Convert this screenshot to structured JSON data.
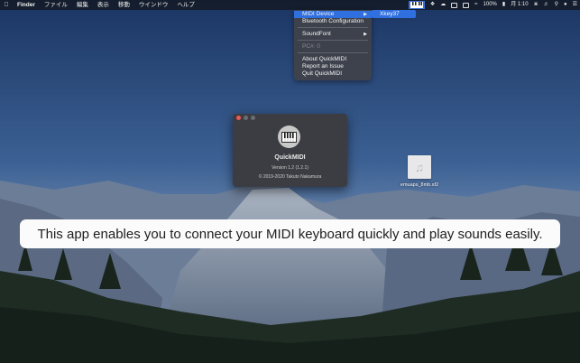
{
  "menubar": {
    "apple_icon": "apple-icon",
    "app_name": "Finder",
    "items": [
      "ファイル",
      "編集",
      "表示",
      "移動",
      "ウインドウ",
      "ヘルプ"
    ],
    "status": {
      "battery": "100%",
      "clock": "月 1:10"
    }
  },
  "menu": {
    "items": [
      {
        "label": "MIDI Device",
        "submenu": true,
        "highlighted": true
      },
      {
        "label": "Bluetooth Configuration"
      },
      {
        "label": "SoundFont",
        "submenu": true
      },
      {
        "label": "PC#: 0",
        "disabled": true
      },
      {
        "label": "About QuickMIDI"
      },
      {
        "label": "Report an Issue"
      },
      {
        "label": "Quit QuickMIDI"
      }
    ],
    "submenu_item": "Xkey37"
  },
  "about": {
    "app_name": "QuickMIDI",
    "version": "Version 1.2 (1.2.1)",
    "copyright": "© 2019-2020 Takuto Nakamura"
  },
  "desktop_file": {
    "name": "emuaps_8mb.sf2",
    "icon": "music-note-icon"
  },
  "caption": "This app enables you to connect your MIDI keyboard quickly and play sounds easily."
}
